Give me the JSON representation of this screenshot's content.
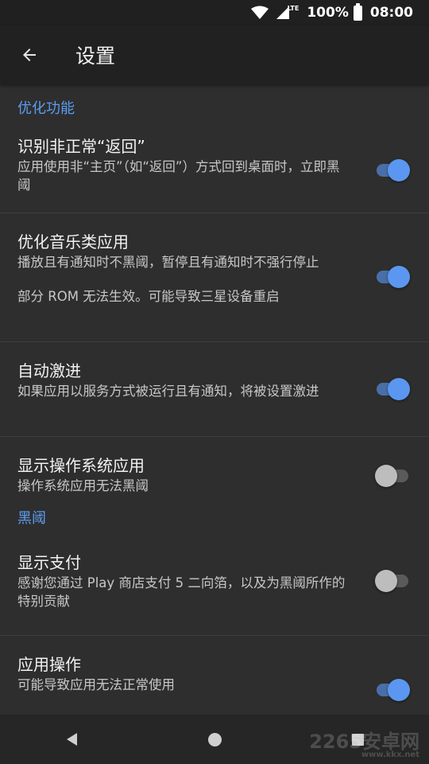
{
  "status_bar": {
    "network_badge": "LTE",
    "battery": "100%",
    "time": "08:00"
  },
  "app_bar": {
    "title": "设置"
  },
  "sections": [
    {
      "header": "优化功能",
      "prefs": [
        {
          "title": "识别非正常“返回”",
          "summary": "应用使用非“主页”（如“返回”）方式回到桌面时，立即黑阈",
          "checked": true
        },
        {
          "title": "优化音乐类应用",
          "summary": "播放且有通知时不黑阈，暂停且有通知时不强行停止",
          "extra": "部分 ROM 无法生效。可能导致三星设备重启",
          "checked": true
        },
        {
          "title": "自动激进",
          "summary": "如果应用以服务方式被运行且有通知，将被设置激进",
          "checked": true
        },
        {
          "title": "显示操作系统应用",
          "summary": "操作系统应用无法黑阈",
          "checked": false
        }
      ]
    },
    {
      "header": "黑阈",
      "prefs": [
        {
          "title": "显示支付",
          "summary": "感谢您通过 Play 商店支付 5 二向箔，以及为黑阈所作的特别贡献",
          "checked": false
        },
        {
          "title": "应用操作",
          "summary": "可能导致应用无法正常使用",
          "checked": true
        }
      ]
    }
  ],
  "watermark": {
    "text": "2265安卓网",
    "url": "www.kkx.net"
  },
  "colors": {
    "accent": "#5c9cf0",
    "background": "#2e2e2e",
    "app_bar": "#212121"
  }
}
